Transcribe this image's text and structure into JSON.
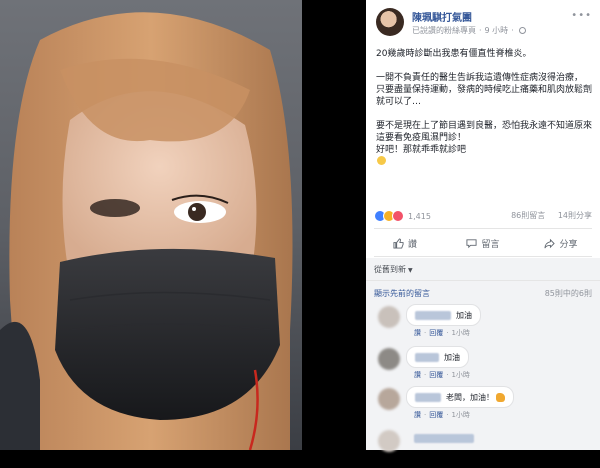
{
  "page": {
    "name": "陳珮騏打氣團",
    "status": "已說讚的粉絲專頁",
    "time": "9 小時"
  },
  "post": {
    "lines": [
      [
        "20幾歲時診斷出我患有僵直性脊椎炎。"
      ],
      [
        "一開不負責任的醫生告訴我這遺傳性症病沒得治療，",
        "只要盡量保持運動，發病的時候吃止痛藥和肌肉放鬆劑就可以了…"
      ],
      [
        "要不是現在上了節目遇到良醫，恐怕我永遠不知道原來這要看免疫風濕門診！",
        "好吧！那就乖乖就診吧"
      ]
    ]
  },
  "engagement": {
    "reaction_count": "1,415",
    "comment_count": "86則留言",
    "share_count": "14則分享"
  },
  "actions": {
    "like": "讚",
    "comment": "留言",
    "share": "分享"
  },
  "comments_section": {
    "sort_label": "從舊到新",
    "view_previous": "顯示先前的留言",
    "count_label": "85則中的6則",
    "reply_like": "讚",
    "reply_label": "回覆",
    "items": [
      {
        "text": "加油",
        "time": "1小時"
      },
      {
        "text": "加油",
        "time": "1小時"
      },
      {
        "text": "老闆，加油！",
        "time": "1小時"
      }
    ]
  },
  "colors": {
    "link": "#365899",
    "muted": "#90949c",
    "text": "#1d2129"
  },
  "icons": [
    "globe-icon",
    "like-icon",
    "comment-icon",
    "share-icon",
    "more-icon"
  ]
}
